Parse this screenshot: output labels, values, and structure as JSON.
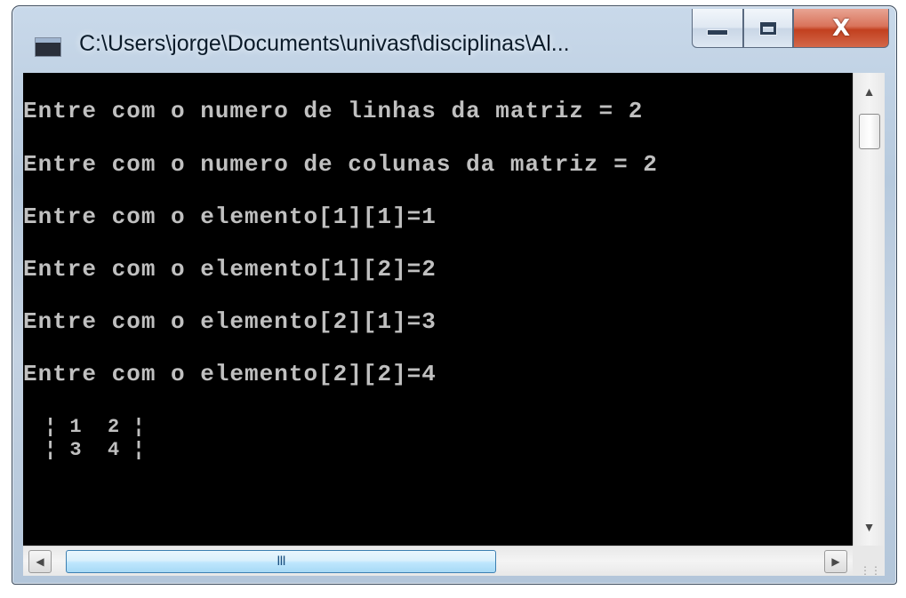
{
  "window": {
    "title": "C:\\Users\\jorge\\Documents\\univasf\\disciplinas\\Al...",
    "close_glyph": "X",
    "icons": {
      "app": "console-app-icon",
      "minimize": "minimize-icon",
      "maximize": "maximize-icon",
      "close": "close-icon"
    }
  },
  "console": {
    "background": "#000000",
    "text_color": "#c0c0c0",
    "lines": [
      "Entre com o numero de linhas da matriz = 2",
      "Entre com o numero de colunas da matriz = 2",
      "Entre com o elemento[1][1]=1",
      "Entre com o elemento[1][2]=2",
      "Entre com o elemento[2][1]=3",
      "Entre com o elemento[2][2]=4"
    ],
    "matrix_rows": [
      "¦ 1  2 ¦",
      "¦ 3  4 ¦"
    ]
  },
  "scrollbars": {
    "vertical": {
      "up_arrow": "▲",
      "down_arrow": "▼"
    },
    "horizontal": {
      "left_arrow": "◀",
      "right_arrow": "▶",
      "grip": "III"
    }
  }
}
